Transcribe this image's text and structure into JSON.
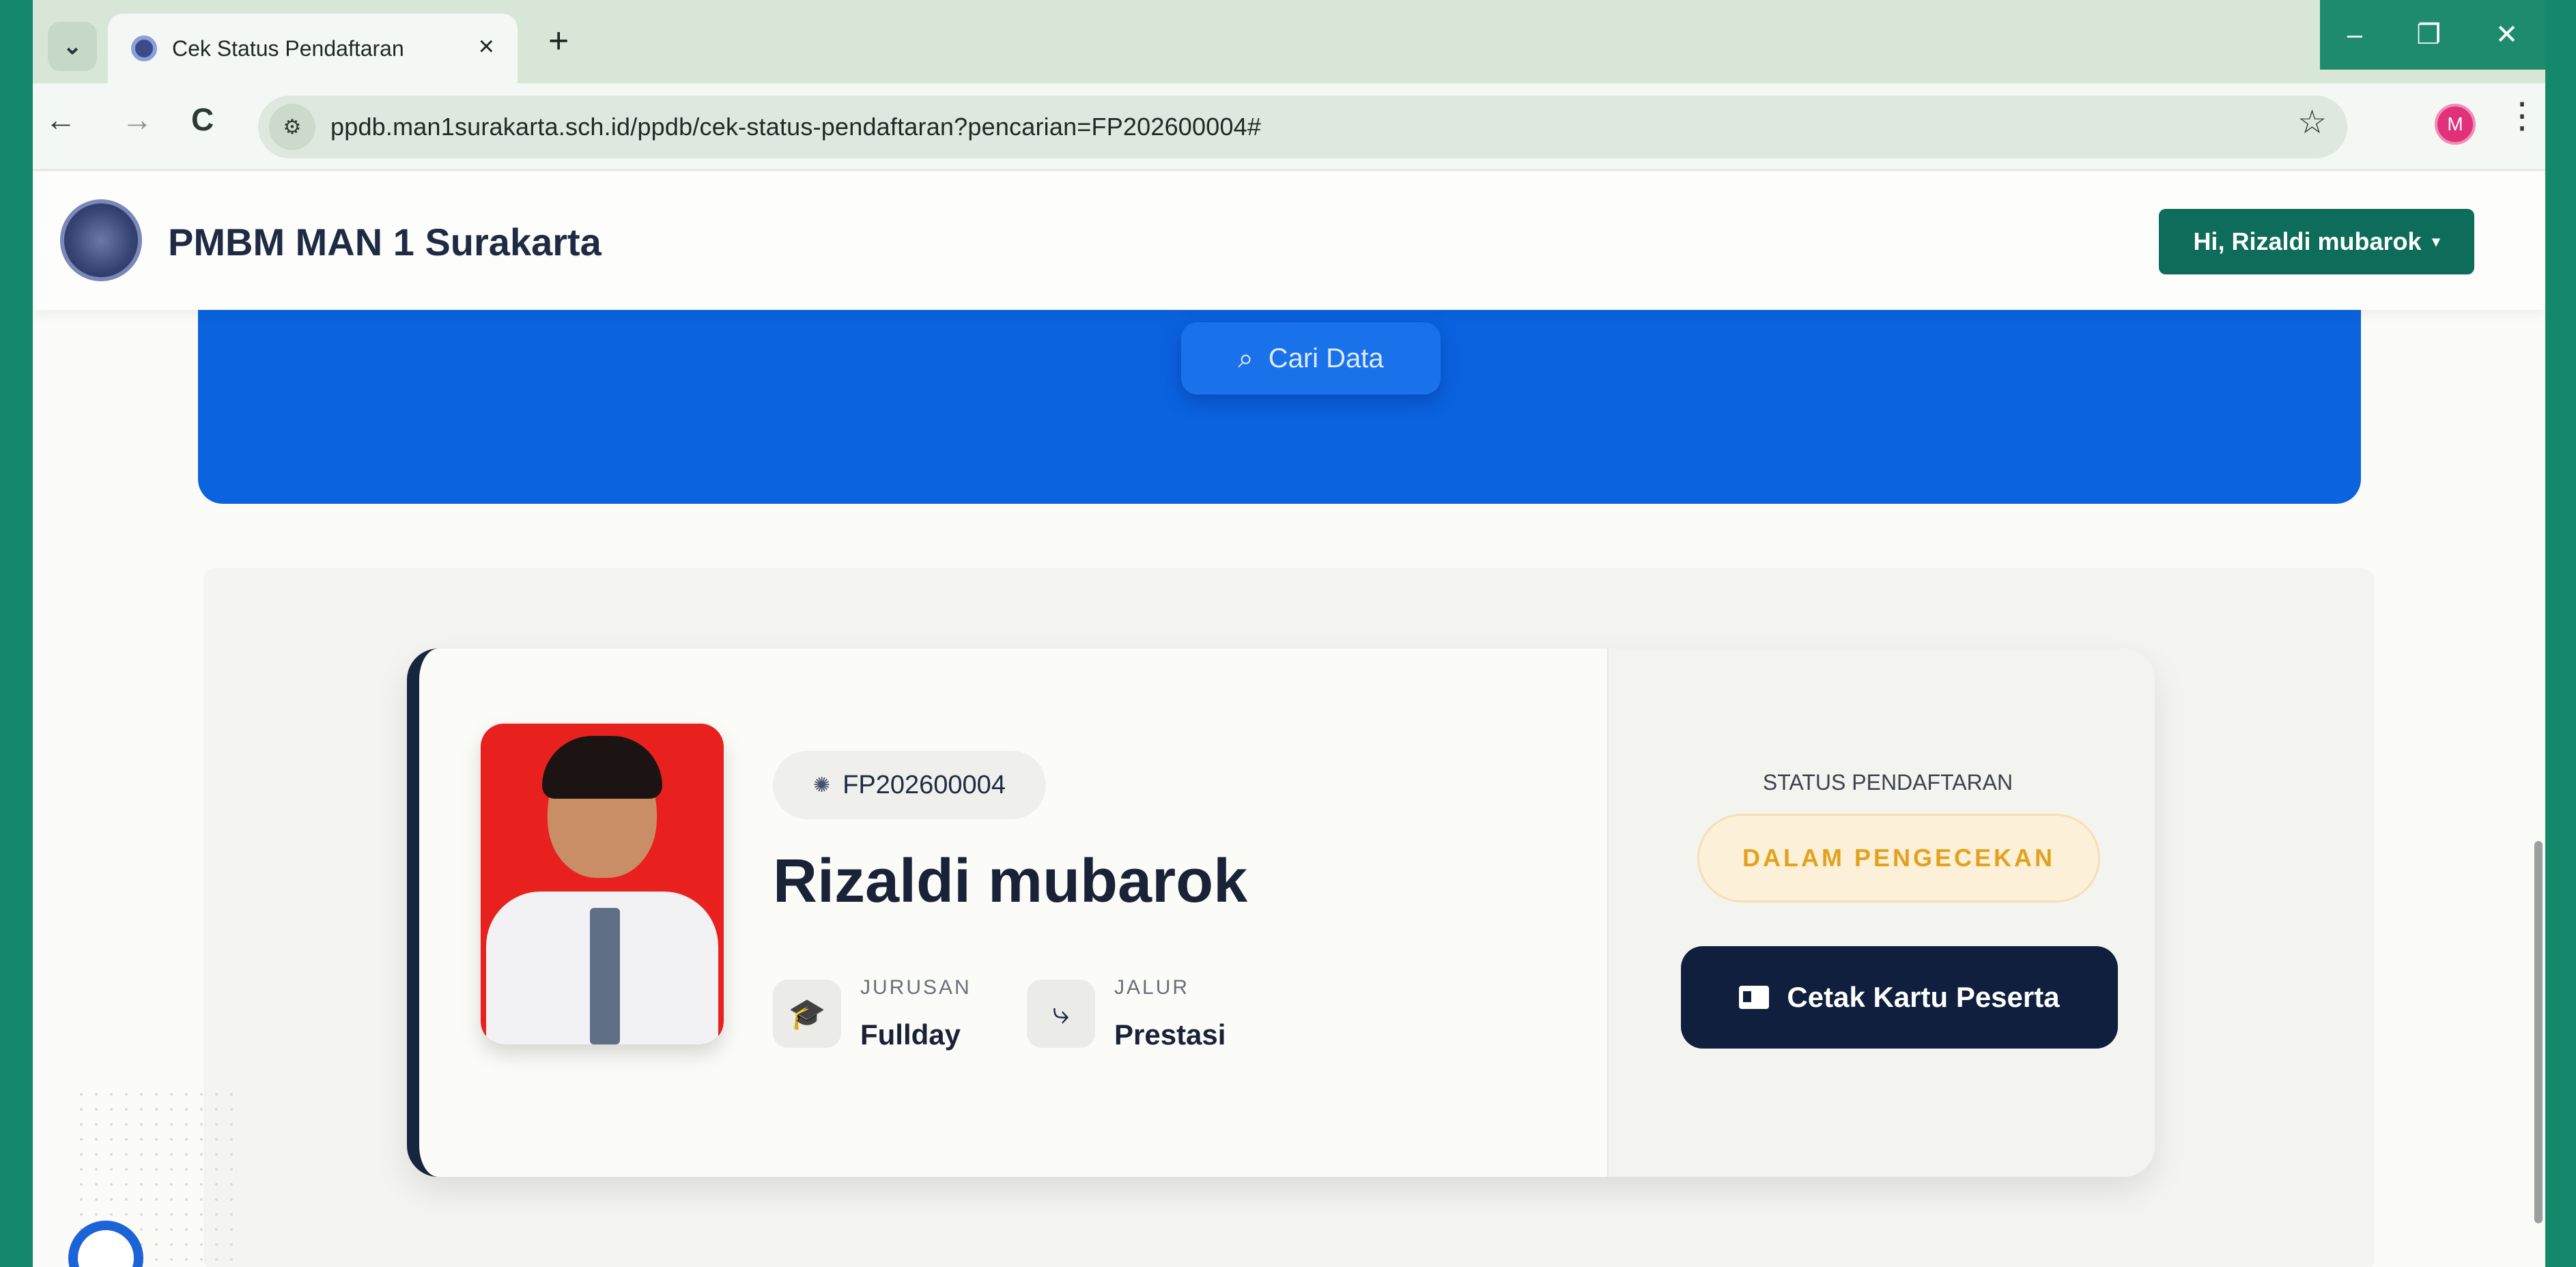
{
  "browser": {
    "tab_title": "Cek Status Pendaftaran",
    "url": "ppdb.man1surakarta.sch.id/ppdb/cek-status-pendaftaran?pencarian=FP202600004#",
    "profile_initial": "M",
    "icons": {
      "back": "←",
      "forward": "→",
      "reload": "C",
      "star": "☆",
      "menu": "⋮",
      "new_tab": "+",
      "close": "×",
      "minimize": "–",
      "maximize": "❐",
      "win_close": "✕",
      "dropdown": "⌄",
      "site_info": "⚙"
    }
  },
  "header": {
    "brand": "PMBM MAN 1 Surakarta",
    "user_menu": "Hi, Rizaldi mubarok",
    "user_caret": "▾"
  },
  "hero": {
    "search_button": "Cari Data",
    "search_icon": "⌕"
  },
  "student": {
    "registration_number": "FP202600004",
    "registration_icon": "✺",
    "name": "Rizaldi mubarok",
    "jurusan_label": "JURUSAN",
    "jurusan_value": "Fullday",
    "jurusan_icon": "🎓",
    "jalur_label": "JALUR",
    "jalur_value": "Prestasi",
    "jalur_icon": "⤷"
  },
  "status": {
    "title": "STATUS PENDAFTARAN",
    "badge": "DALAM PENGECEKAN",
    "print_button": "Cetak Kartu Peserta"
  },
  "colors": {
    "primary_blue": "#0b63df",
    "header_green": "#0d6d5a",
    "status_amber": "#e3a21e",
    "navy": "#0f1f3d"
  }
}
